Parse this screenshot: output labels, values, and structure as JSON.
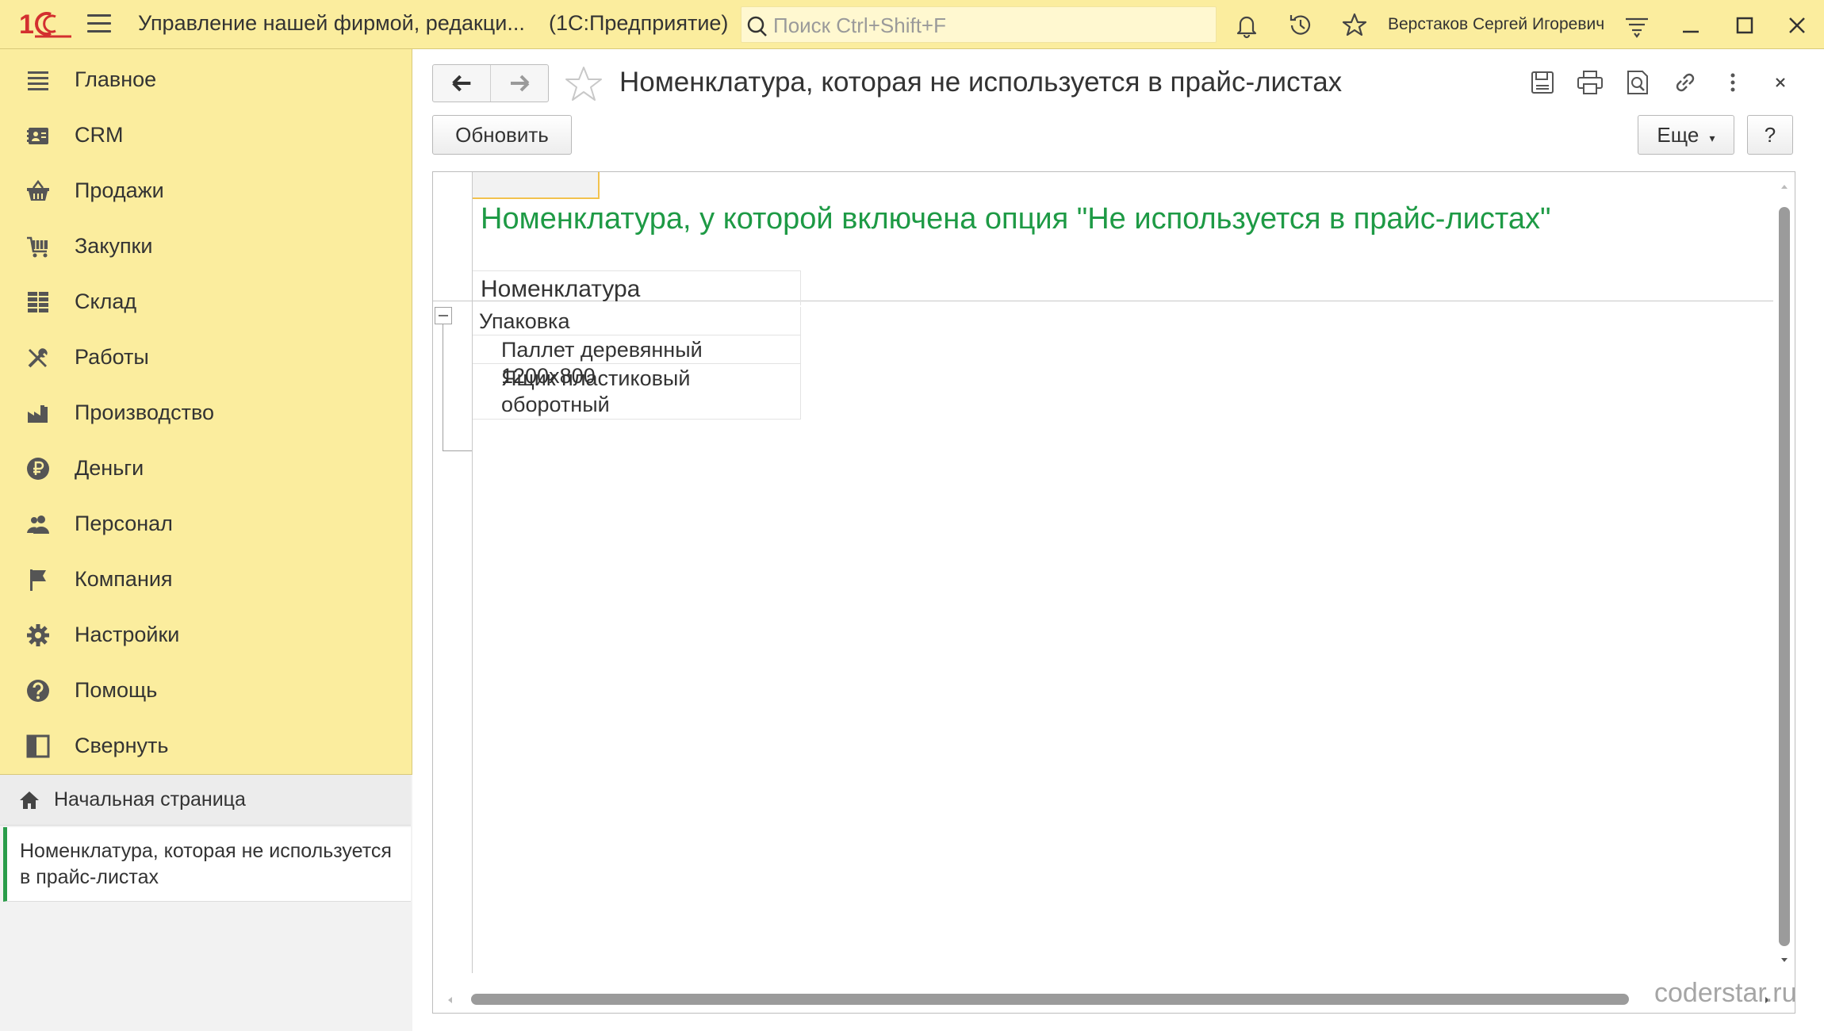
{
  "topbar": {
    "app_title": "Управление нашей фирмой, редакци...",
    "app_subtitle": "(1С:Предприятие)",
    "search_placeholder": "Поиск Ctrl+Shift+F",
    "user_name": "Верстаков Сергей Игоревич",
    "icons": [
      "logo-1c",
      "menu-icon",
      "bell-icon",
      "history-icon",
      "star-icon",
      "settings-funnel-icon",
      "minimize-icon",
      "maximize-icon",
      "close-icon"
    ]
  },
  "sidebar": {
    "items": [
      {
        "label": "Главное",
        "icon": "list-icon"
      },
      {
        "label": "CRM",
        "icon": "contact-card-icon"
      },
      {
        "label": "Продажи",
        "icon": "basket-icon"
      },
      {
        "label": "Закупки",
        "icon": "cart-icon"
      },
      {
        "label": "Склад",
        "icon": "warehouse-grid-icon"
      },
      {
        "label": "Работы",
        "icon": "tools-icon"
      },
      {
        "label": "Производство",
        "icon": "factory-icon"
      },
      {
        "label": "Деньги",
        "icon": "ruble-icon"
      },
      {
        "label": "Персонал",
        "icon": "people-icon"
      },
      {
        "label": "Компания",
        "icon": "flag-icon"
      },
      {
        "label": "Настройки",
        "icon": "gear-icon"
      },
      {
        "label": "Помощь",
        "icon": "help-icon"
      },
      {
        "label": "Свернуть",
        "icon": "collapse-panel-icon"
      }
    ],
    "home_label": "Начальная страница",
    "open_window_label": "Номенклатура, которая не используется в прайс-листах"
  },
  "main": {
    "page_title": "Номенклатура, которая не используется в прайс-листах",
    "refresh_label": "Обновить",
    "more_label": "Еще",
    "help_label": "?"
  },
  "report": {
    "heading": "Номенклатура, у которой включена опция \"Не используется в прайс-листах\"",
    "column_header": "Номенклатура",
    "rows": [
      {
        "text": "Упаковка",
        "level": 0
      },
      {
        "text": "Паллет деревянный 1200х800",
        "level": 1
      },
      {
        "text": "Ящик пластиковый оборотный",
        "level": 1
      }
    ]
  },
  "watermark": "coderstar.ru",
  "colors": {
    "panel_yellow": "#fbed9e",
    "heading_green": "#1e9a45",
    "active_tab_green": "#2a9d4a",
    "logo_red": "#d32f2f"
  }
}
